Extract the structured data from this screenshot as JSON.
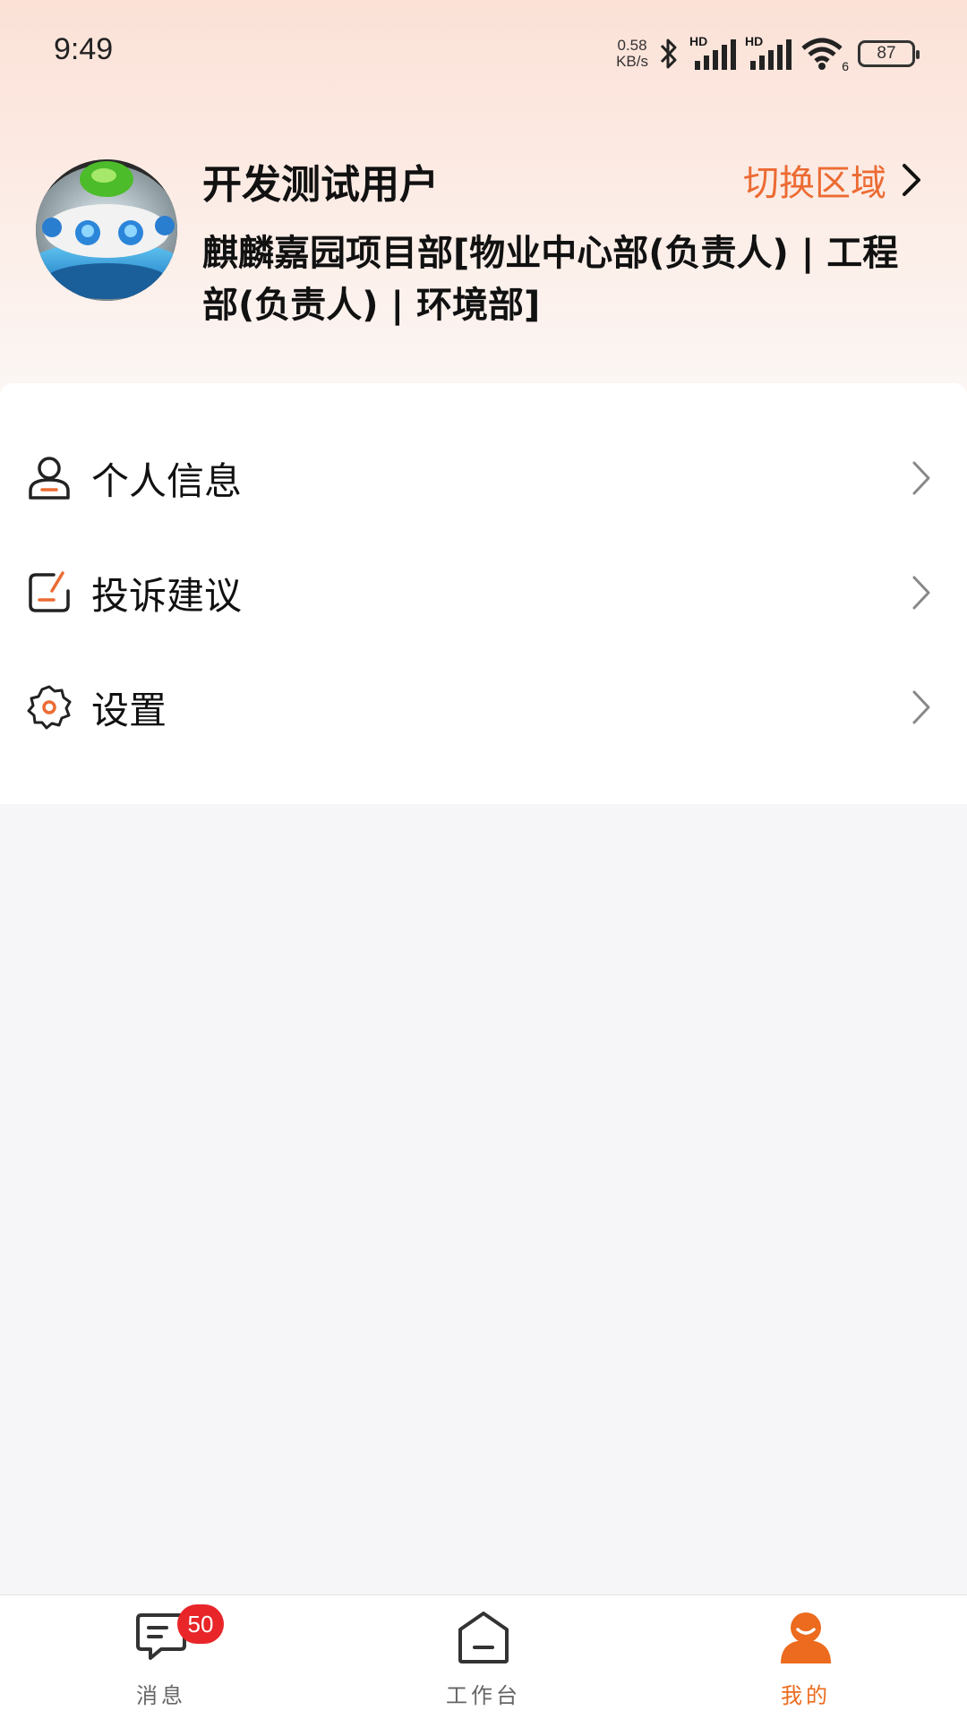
{
  "status_bar": {
    "time": "9:49",
    "net_speed_value": "0.58",
    "net_speed_unit": "KB/s",
    "signal_1_label": "HD",
    "signal_2_label": "HD",
    "wifi_label": "6",
    "battery": "87"
  },
  "profile": {
    "name": "开发测试用户",
    "switch_region_label": "切换区域",
    "organization": "麒麟嘉园项目部[物业中心部(负责人) | 工程部(负责人) | 环境部]"
  },
  "menu": {
    "items": [
      {
        "label": "个人信息",
        "icon": "person-icon"
      },
      {
        "label": "投诉建议",
        "icon": "feedback-icon"
      },
      {
        "label": "设置",
        "icon": "gear-icon"
      }
    ]
  },
  "tab_bar": {
    "tabs": [
      {
        "label": "消息",
        "icon": "message-icon",
        "badge": "50",
        "active": false
      },
      {
        "label": "工作台",
        "icon": "home-icon",
        "active": false
      },
      {
        "label": "我的",
        "icon": "user-icon",
        "active": true
      }
    ]
  },
  "colors": {
    "accent": "#ec6b33",
    "badge": "#e8262a",
    "header_gradient_top": "#fbe1d6"
  }
}
